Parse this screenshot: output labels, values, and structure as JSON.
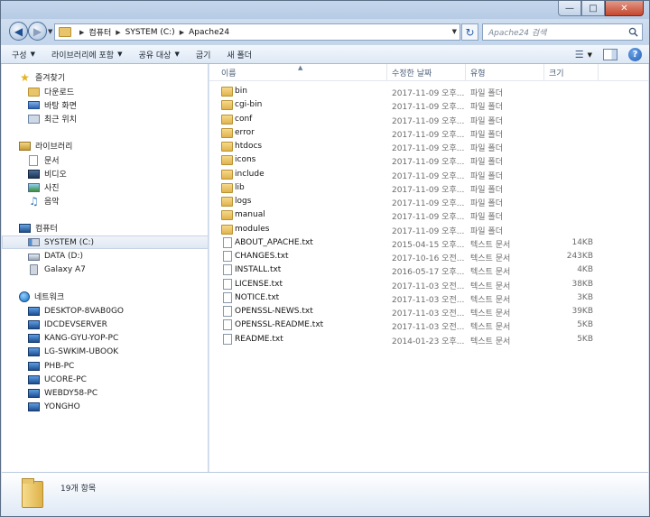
{
  "address": {
    "crumbs": [
      "컴퓨터",
      "SYSTEM (C:)",
      "Apache24"
    ],
    "search_placeholder": "Apache24 검색"
  },
  "toolbar": {
    "items": [
      {
        "label": "구성",
        "dropdown": true
      },
      {
        "label": "라이브러리에 포함",
        "dropdown": true
      },
      {
        "label": "공유 대상",
        "dropdown": true
      },
      {
        "label": "굽기",
        "dropdown": false
      },
      {
        "label": "새 폴더",
        "dropdown": false
      }
    ]
  },
  "nav": {
    "favorites": {
      "label": "즐겨찾기",
      "items": [
        "다운로드",
        "바탕 화면",
        "최근 위치"
      ]
    },
    "libraries": {
      "label": "라이브러리",
      "items": [
        "문서",
        "비디오",
        "사진",
        "음악"
      ]
    },
    "computer": {
      "label": "컴퓨터",
      "items": [
        "SYSTEM (C:)",
        "DATA (D:)",
        "Galaxy A7"
      ],
      "selected": "SYSTEM (C:)"
    },
    "network": {
      "label": "네트워크",
      "items": [
        "DESKTOP-8VAB0GO",
        "IDCDEVSERVER",
        "KANG-GYU-YOP-PC",
        "LG-SWKIM-UBOOK",
        "PHB-PC",
        "UCORE-PC",
        "WEBDY58-PC",
        "YONGHO"
      ]
    }
  },
  "columns": {
    "name": "이름",
    "date": "수정한 날짜",
    "type": "유형",
    "size": "크기"
  },
  "files": [
    {
      "name": "bin",
      "date": "2017-11-09 오후...",
      "type": "파일 폴더",
      "size": "",
      "kind": "folder"
    },
    {
      "name": "cgi-bin",
      "date": "2017-11-09 오후...",
      "type": "파일 폴더",
      "size": "",
      "kind": "folder"
    },
    {
      "name": "conf",
      "date": "2017-11-09 오후...",
      "type": "파일 폴더",
      "size": "",
      "kind": "folder"
    },
    {
      "name": "error",
      "date": "2017-11-09 오후...",
      "type": "파일 폴더",
      "size": "",
      "kind": "folder"
    },
    {
      "name": "htdocs",
      "date": "2017-11-09 오후...",
      "type": "파일 폴더",
      "size": "",
      "kind": "folder"
    },
    {
      "name": "icons",
      "date": "2017-11-09 오후...",
      "type": "파일 폴더",
      "size": "",
      "kind": "folder"
    },
    {
      "name": "include",
      "date": "2017-11-09 오후...",
      "type": "파일 폴더",
      "size": "",
      "kind": "folder"
    },
    {
      "name": "lib",
      "date": "2017-11-09 오후...",
      "type": "파일 폴더",
      "size": "",
      "kind": "folder"
    },
    {
      "name": "logs",
      "date": "2017-11-09 오후...",
      "type": "파일 폴더",
      "size": "",
      "kind": "folder"
    },
    {
      "name": "manual",
      "date": "2017-11-09 오후...",
      "type": "파일 폴더",
      "size": "",
      "kind": "folder"
    },
    {
      "name": "modules",
      "date": "2017-11-09 오후...",
      "type": "파일 폴더",
      "size": "",
      "kind": "folder"
    },
    {
      "name": "ABOUT_APACHE.txt",
      "date": "2015-04-15 오후...",
      "type": "텍스트 문서",
      "size": "14KB",
      "kind": "file"
    },
    {
      "name": "CHANGES.txt",
      "date": "2017-10-16 오전...",
      "type": "텍스트 문서",
      "size": "243KB",
      "kind": "file"
    },
    {
      "name": "INSTALL.txt",
      "date": "2016-05-17 오후...",
      "type": "텍스트 문서",
      "size": "4KB",
      "kind": "file"
    },
    {
      "name": "LICENSE.txt",
      "date": "2017-11-03 오전...",
      "type": "텍스트 문서",
      "size": "38KB",
      "kind": "file"
    },
    {
      "name": "NOTICE.txt",
      "date": "2017-11-03 오전...",
      "type": "텍스트 문서",
      "size": "3KB",
      "kind": "file"
    },
    {
      "name": "OPENSSL-NEWS.txt",
      "date": "2017-11-03 오전...",
      "type": "텍스트 문서",
      "size": "39KB",
      "kind": "file"
    },
    {
      "name": "OPENSSL-README.txt",
      "date": "2017-11-03 오전...",
      "type": "텍스트 문서",
      "size": "5KB",
      "kind": "file"
    },
    {
      "name": "README.txt",
      "date": "2014-01-23 오후...",
      "type": "텍스트 문서",
      "size": "5KB",
      "kind": "file"
    }
  ],
  "status": {
    "count": "19개 항목"
  }
}
